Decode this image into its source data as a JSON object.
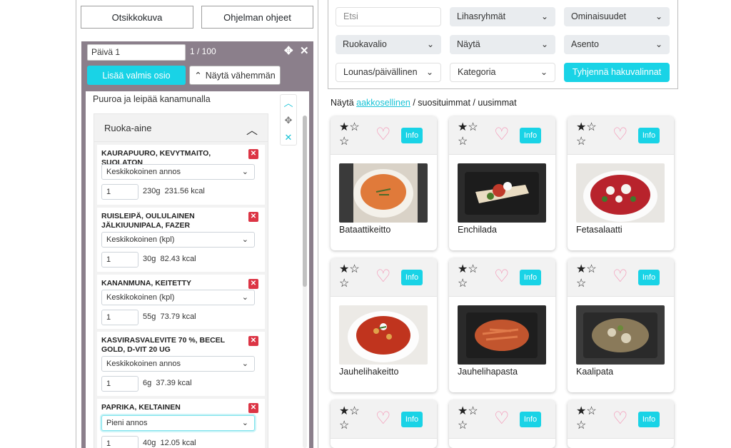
{
  "left": {
    "buttons": {
      "cover": "Otsikkokuva",
      "instructions": "Ohjelman ohjeet"
    },
    "day": {
      "name": "Päivä 1",
      "count": "1 / 100",
      "move_icon": "move-icon",
      "close_icon": "close-icon"
    },
    "add_button": "Lisää valmis osio",
    "less_button": "Näytä vähemmän",
    "meal": {
      "title": "Puuroa ja leipää kanamunalla",
      "section": "Ruoka-aine",
      "items": [
        {
          "name": "KAURAPUURO, KEVYTMAITO, SUOLATON",
          "portion": "Keskikokoinen annos",
          "qty": "1",
          "grams": "230g",
          "kcal": "231.56 kcal"
        },
        {
          "name": "RUISLEIPÄ, OULULAINEN JÄLKIUUNIPALA, FAZER",
          "portion": "Keskikokoinen (kpl)",
          "qty": "1",
          "grams": "30g",
          "kcal": "82.43 kcal"
        },
        {
          "name": "KANANMUNA, KEITETTY",
          "portion": "Keskikokoinen (kpl)",
          "qty": "1",
          "grams": "55g",
          "kcal": "73.79 kcal"
        },
        {
          "name": "KASVIRASVALEVITE 70 %, BECEL GOLD, D-VIT 20 UG",
          "portion": "Keskikokoinen annos",
          "qty": "1",
          "grams": "6g",
          "kcal": "37.39 kcal"
        },
        {
          "name": "PAPRIKA, KELTAINEN",
          "portion": "Pieni annos",
          "qty": "1",
          "grams": "40g",
          "kcal": "12.05 kcal"
        }
      ]
    }
  },
  "filters": {
    "search_placeholder": "Etsi",
    "muscle": "Lihasryhmät",
    "properties": "Ominaisuudet",
    "menu": "Ruokavalio",
    "show": "Näytä",
    "position": "Asento",
    "meal_type": "Lounas/päivällinen",
    "category": "Kategoria",
    "clear": "Tyhjennä hakuvalinnat"
  },
  "sort": {
    "prefix": "Näytä ",
    "alphabetical": "aakkosellinen",
    "rest": " / suosituimmat / uusimmat"
  },
  "recipes": {
    "info_label": "Info",
    "star": "★",
    "star_empty": "☆",
    "heart": "♡",
    "cards": [
      {
        "name": "Bataattikeitto"
      },
      {
        "name": "Enchilada"
      },
      {
        "name": "Fetasalaatti"
      },
      {
        "name": "Jauhelihakeitto"
      },
      {
        "name": "Jauhelihapasta"
      },
      {
        "name": "Kaalipata"
      },
      {
        "name": ""
      },
      {
        "name": ""
      },
      {
        "name": ""
      }
    ]
  },
  "colors": {
    "accent": "#19d3e6",
    "panel": "#8b7f8b",
    "delete": "#dc3545",
    "heart": "#f48fb1"
  }
}
